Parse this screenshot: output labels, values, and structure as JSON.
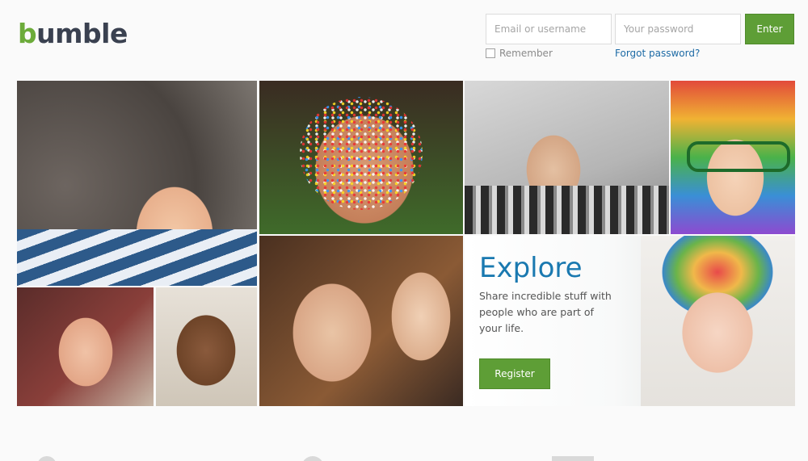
{
  "brand": {
    "logo_first": "b",
    "logo_rest": "umble"
  },
  "login": {
    "email_placeholder": "Email or username",
    "password_placeholder": "Your password",
    "enter_label": "Enter",
    "remember_label": "Remember",
    "forgot_label": "Forgot password?"
  },
  "explore": {
    "title": "Explore",
    "text": "Share incredible stuff with people who are part of your life.",
    "register_label": "Register"
  },
  "colors": {
    "brand_green": "#5e9e36",
    "link_blue": "#1c6aa5",
    "explore_blue": "#1a79b0",
    "logo_dark": "#3a4150"
  }
}
